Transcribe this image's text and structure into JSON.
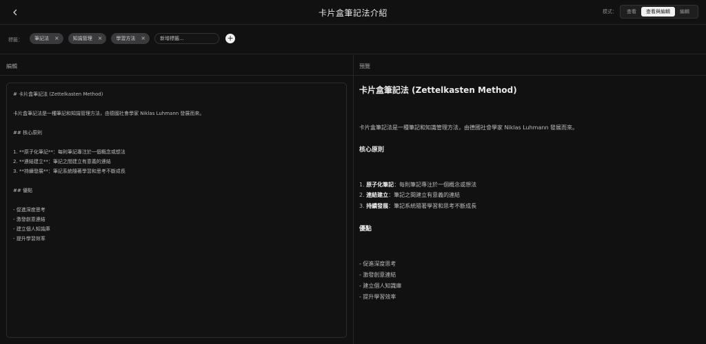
{
  "header": {
    "title": "卡片盒筆記法介紹",
    "mode_label": "模式：",
    "modes": [
      "查看",
      "查看與編輯",
      "編輯"
    ]
  },
  "tags": {
    "label": "標籤：",
    "items": [
      "筆記法",
      "知識管理",
      "學習方法"
    ],
    "input_placeholder": "新增標籤..."
  },
  "editor": {
    "heading": "編輯",
    "lines": [
      "# 卡片盒筆記法 (Zettelkasten Method)",
      "",
      "卡片盒筆記法是一種筆記和知識管理方法，由德國社會學家 Niklas Luhmann 發展而來。",
      "",
      "## 核心原則",
      "",
      "1. **原子化筆記**：每則筆記專注於一個概念或想法",
      "2. **連結建立**：筆記之間建立有意義的連結",
      "3. **持續發展**：筆記系統隨著學習和思考不斷成長",
      "",
      "## 優點",
      "",
      "- 促進深度思考",
      "- 激發創意連結",
      "- 建立個人知識庫",
      "- 提升學習效率"
    ]
  },
  "preview": {
    "heading": "預覽",
    "h1": "卡片盒筆記法 (Zettelkasten Method)",
    "intro": "卡片盒筆記法是一種筆記和知識管理方法，由德國社會學家 Niklas Luhmann 發展而來。",
    "h2_principles": "核心原則",
    "principles": [
      {
        "num": "1.",
        "term": "原子化筆記",
        "desc": "：每則筆記專注於一個概念或想法"
      },
      {
        "num": "2.",
        "term": "連結建立",
        "desc": "：筆記之間建立有意義的連結"
      },
      {
        "num": "3.",
        "term": "持續發展",
        "desc": "：筆記系統隨著學習和思考不斷成長"
      }
    ],
    "h2_benefits": "優點",
    "benefits": [
      "- 促進深度思考",
      "- 激發創意連結",
      "- 建立個人知識庫",
      "- 提升學習效率"
    ]
  }
}
